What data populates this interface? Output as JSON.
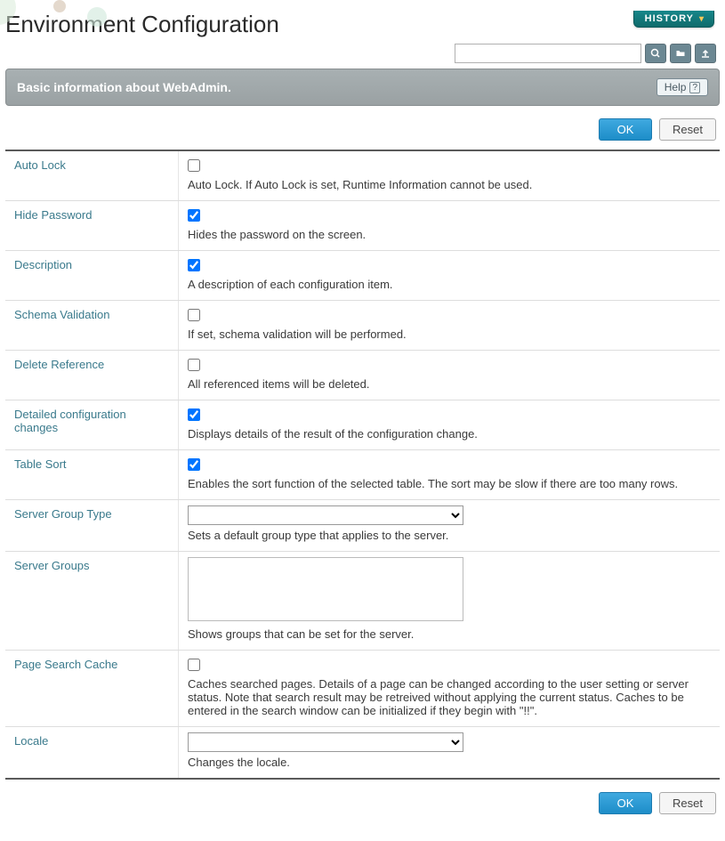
{
  "header": {
    "title": "Environment Configuration",
    "history_label": "HISTORY"
  },
  "toolbar": {
    "search_placeholder": "",
    "search_icon": "search",
    "import_icon": "import",
    "export_icon": "export"
  },
  "subheader": {
    "text": "Basic information about WebAdmin.",
    "help_label": "Help"
  },
  "buttons": {
    "ok": "OK",
    "reset": "Reset"
  },
  "fields": {
    "auto_lock": {
      "label": "Auto Lock",
      "checked": false,
      "desc": "Auto Lock. If Auto Lock is set, Runtime Information cannot be used."
    },
    "hide_password": {
      "label": "Hide Password",
      "checked": true,
      "desc": "Hides the password on the screen."
    },
    "description": {
      "label": "Description",
      "checked": true,
      "desc": "A description of each configuration item."
    },
    "schema_validation": {
      "label": "Schema Validation",
      "checked": false,
      "desc": "If set, schema validation will be performed."
    },
    "delete_reference": {
      "label": "Delete Reference",
      "checked": false,
      "desc": "All referenced items will be deleted."
    },
    "detailed_changes": {
      "label": "Detailed configuration changes",
      "checked": true,
      "desc": "Displays details of the result of the configuration change."
    },
    "table_sort": {
      "label": "Table Sort",
      "checked": true,
      "desc": "Enables the sort function of the selected table. The sort may be slow if there are too many rows."
    },
    "server_group_type": {
      "label": "Server Group Type",
      "value": "",
      "desc": "Sets a default group type that applies to the server."
    },
    "server_groups": {
      "label": "Server Groups",
      "value": "",
      "desc": "Shows groups that can be set for the server."
    },
    "page_search_cache": {
      "label": "Page Search Cache",
      "checked": false,
      "desc": "Caches searched pages. Details of a page can be changed according to the user setting or server status. Note that search result may be retreived without applying the current status. Caches to be entered in the search window can be initialized if they begin with \"!!\"."
    },
    "locale": {
      "label": "Locale",
      "value": "",
      "desc": "Changes the locale."
    }
  }
}
